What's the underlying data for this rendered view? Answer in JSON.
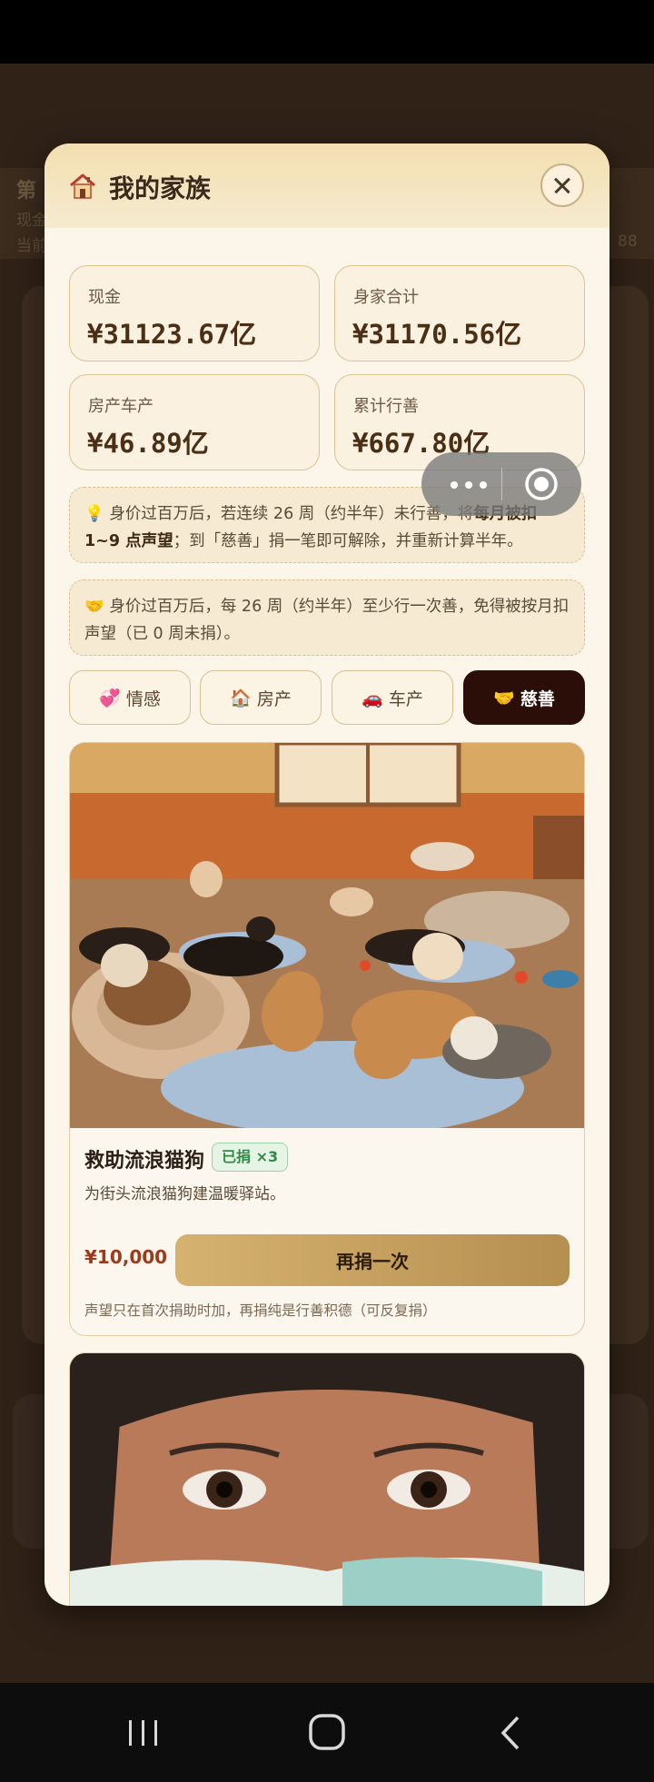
{
  "background": {
    "title_fragment": "第",
    "line1_fragment": "现金",
    "line2_fragment": "当前",
    "right_fragment": "88"
  },
  "modal": {
    "title": "我的家族",
    "house_icon": "house-icon",
    "close_icon": "close-icon"
  },
  "stats": [
    {
      "label": "现金",
      "value": "¥31123.67亿"
    },
    {
      "label": "身家合计",
      "value": "¥31170.56亿"
    },
    {
      "label": "房产车产",
      "value": "¥46.89亿"
    },
    {
      "label": "累计行善",
      "value": "¥667.80亿"
    }
  ],
  "notices": {
    "warning_icon": "lightbulb-icon",
    "warning_part1": "身价过百万后，若连续 26 周（约半年）未行善，将",
    "warning_bold": "每月被扣 1~9 点声望",
    "warning_part2": "；到「慈善」捐一笔即可解除，并重新计算半年。",
    "rule_icon": "handshake-icon",
    "rule_text": "身价过百万后，每 26 周（约半年）至少行一次善，免得被按月扣声望（已 0 周未捐）。"
  },
  "tabs": [
    {
      "icon": "💞",
      "label": "情感"
    },
    {
      "icon": "🏠",
      "label": "房产"
    },
    {
      "icon": "🚗",
      "label": "车产"
    },
    {
      "icon": "🤝",
      "label": "慈善"
    }
  ],
  "active_tab": "慈善",
  "charity_card": {
    "title": "救助流浪猫狗",
    "badge": "已捐 ×3",
    "description": "为街头流浪猫狗建温暖驿站。",
    "price": "¥10,000",
    "button": "再捐一次",
    "footnote": "声望只在首次捐助时加，再捐纯是行善积德（可反复捐）"
  },
  "colors": {
    "accent_dark": "#2b0e08",
    "gold": "#c8a45f",
    "badge_green": "#2e8a45",
    "price_red": "#9c3a1c"
  }
}
